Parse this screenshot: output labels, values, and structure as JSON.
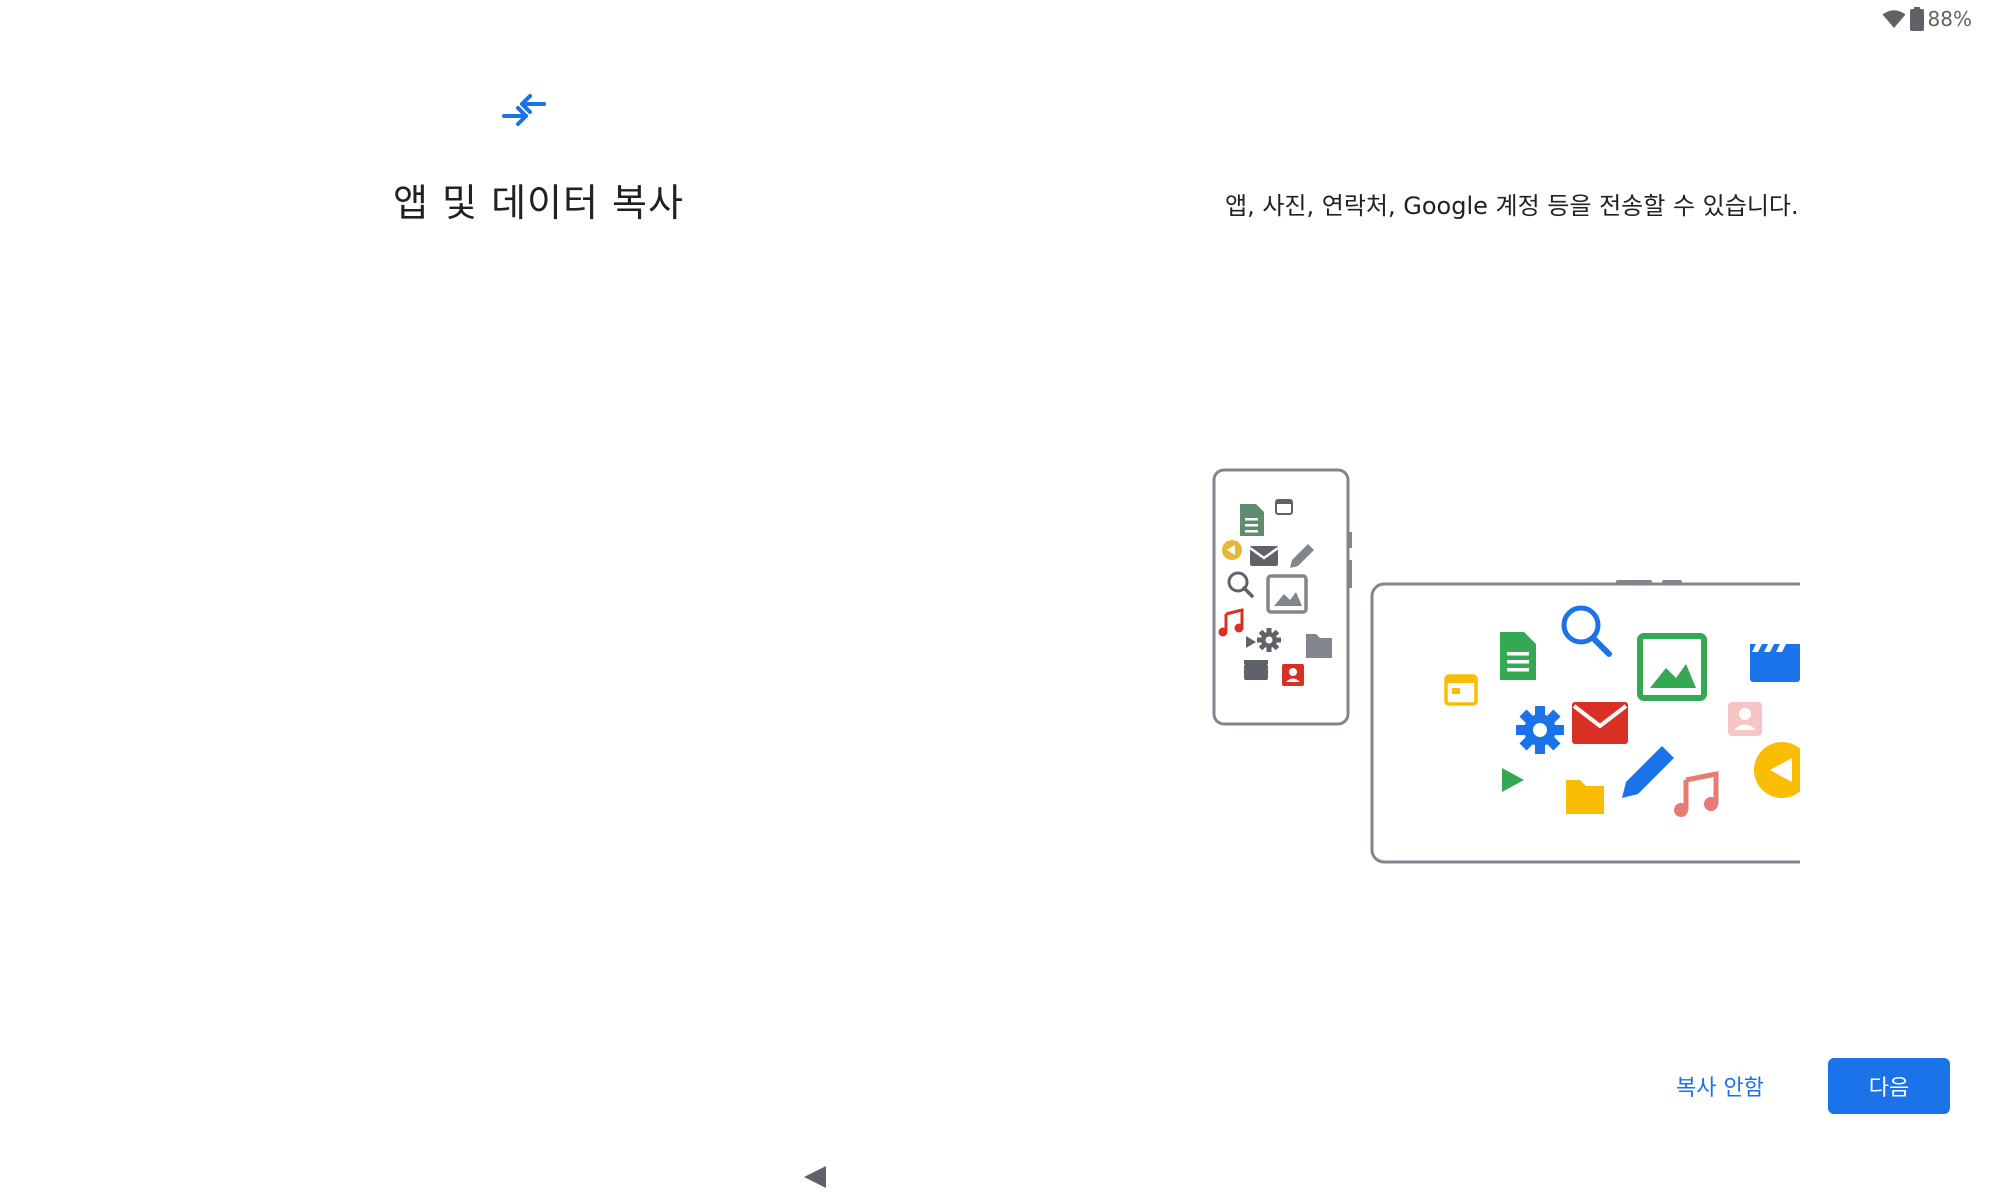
{
  "status": {
    "battery": "88%",
    "icons": [
      "wifi-icon",
      "battery-icon"
    ]
  },
  "header": {
    "icon": "transfer-arrows-icon",
    "title": "앱 및 데이터 복사"
  },
  "main": {
    "description": "앱, 사진, 연락처, Google 계정 등을 전송할 수 있습니다."
  },
  "actions": {
    "skip_label": "복사 안함",
    "next_label": "다음"
  },
  "nav": {
    "back_icon": "back-triangle-icon"
  },
  "colors": {
    "accent": "#1a73e8",
    "green": "#34a853",
    "red": "#d93025",
    "yellow": "#fbbc04",
    "gray": "#5f6368"
  }
}
